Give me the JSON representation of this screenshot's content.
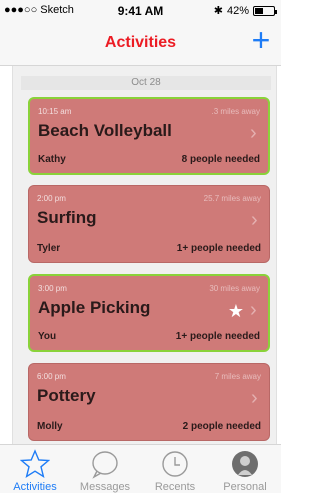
{
  "status_bar": {
    "carrier": "●●●○○ Sketch",
    "time": "9:41 AM",
    "battery": "42%",
    "battery_fraction": 0.42
  },
  "nav": {
    "title": "Activities",
    "add_label": "+"
  },
  "date_header": "Oct 28",
  "activities": [
    {
      "time": "10:15 am",
      "distance": ".3 miles away",
      "title": "Beach Volleyball",
      "name": "Kathy",
      "needed": "8 people needed",
      "highlight": true,
      "starred": false
    },
    {
      "time": "2:00 pm",
      "distance": "25.7 miles away",
      "title": "Surfing",
      "name": "Tyler",
      "needed": "1+ people needed",
      "highlight": false,
      "starred": false
    },
    {
      "time": "3:00 pm",
      "distance": "30 miles away",
      "title": "Apple Picking",
      "name": "You",
      "needed": "1+ people needed",
      "highlight": true,
      "starred": true
    },
    {
      "time": "6:00 pm",
      "distance": "7 miles away",
      "title": "Pottery",
      "name": "Molly",
      "needed": "2 people needed",
      "highlight": false,
      "starred": false
    }
  ],
  "tabs": [
    {
      "label": "Activities",
      "icon": "star-icon",
      "active": true
    },
    {
      "label": "Messages",
      "icon": "chat-bubble-icon",
      "active": false
    },
    {
      "label": "Recents",
      "icon": "clock-icon",
      "active": false
    },
    {
      "label": "Personal",
      "icon": "person-icon",
      "active": false
    }
  ],
  "colors": {
    "accent_red": "#ec1c24",
    "accent_blue": "#1e7cf6",
    "card_bg": "#cf7a78",
    "highlight_border": "#8ad23a"
  }
}
